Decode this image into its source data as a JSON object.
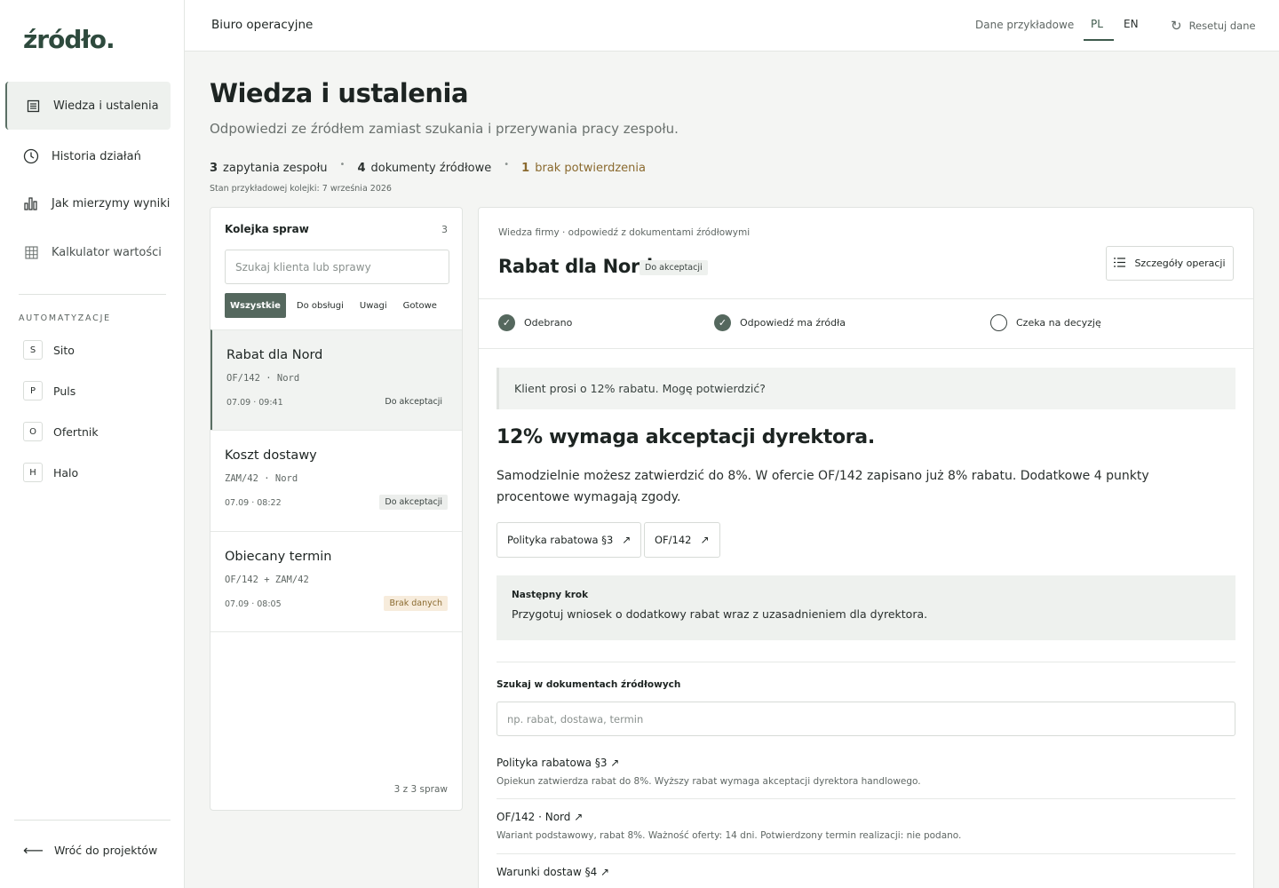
{
  "sidebar": {
    "logo": "źródło.",
    "nav": [
      {
        "label": "Wiedza i ustalenia",
        "icon": "list-icon"
      },
      {
        "label": "Historia działań",
        "icon": "clock-icon"
      },
      {
        "label": "Jak mierzymy wyniki",
        "icon": "bar-chart-icon"
      },
      {
        "label": "Kalkulator wartości",
        "icon": "grid-icon"
      }
    ],
    "section_label": "AUTOMATYZACJE",
    "automations": [
      {
        "badge": "S",
        "label": "Sito"
      },
      {
        "badge": "P",
        "label": "Puls"
      },
      {
        "badge": "O",
        "label": "Ofertnik"
      },
      {
        "badge": "H",
        "label": "Halo"
      }
    ],
    "back_label": "Wróć do projektów"
  },
  "topbar": {
    "title": "Biuro operacyjne",
    "sample_data": "Dane przykładowe",
    "lang_pl": "PL",
    "lang_en": "EN",
    "reset": "Resetuj dane"
  },
  "header": {
    "title": "Wiedza i ustalenia",
    "subtitle": "Odpowiedzi ze źródłem zamiast szukania i przerywania pracy zespołu.",
    "stats": [
      {
        "num": "3",
        "label": "zapytania zespołu"
      },
      {
        "num": "4",
        "label": "dokumenty źródłowe"
      },
      {
        "num": "1",
        "label": "brak potwierdzenia"
      }
    ],
    "queue_state": "Stan przykładowej kolejki: 7 września 2026"
  },
  "queue": {
    "title": "Kolejka spraw",
    "count": "3",
    "search_placeholder": "Szukaj klienta lub sprawy",
    "filters": [
      "Wszystkie",
      "Do obsługi",
      "Uwagi",
      "Gotowe"
    ],
    "items": [
      {
        "title": "Rabat dla Nord",
        "ref": "OF/142 · Nord",
        "time": "07.09 · 09:41",
        "badge": "Do akceptacji"
      },
      {
        "title": "Koszt dostawy",
        "ref": "ZAM/42 · Nord",
        "time": "07.09 · 08:22",
        "badge": "Do akceptacji"
      },
      {
        "title": "Obiecany termin",
        "ref": "OF/142 + ZAM/42",
        "time": "07.09 · 08:05",
        "badge": "Brak danych"
      }
    ],
    "footer": "3 z 3 spraw"
  },
  "detail": {
    "crumb": "Wiedza firmy · odpowiedź z dokumentami źródłowymi",
    "title": "Rabat dla Nord",
    "status": "Do akceptacji",
    "details_button": "Szczegóły operacji",
    "steps": [
      "Odebrano",
      "Odpowiedź ma źródła",
      "Czeka na decyzję"
    ],
    "question": "Klient prosi o 12% rabatu. Mogę potwierdzić?",
    "answer_title": "12% wymaga akceptacji dyrektora.",
    "answer_body": "Samodzielnie możesz zatwierdzić do 8%. W ofercie OF/142 zapisano już 8% rabatu. Dodatkowe 4 punkty procentowe wymagają zgody.",
    "sources": [
      "Polityka rabatowa §3",
      "OF/142"
    ],
    "next_label": "Następny krok",
    "next_text": "Przygotuj wniosek o dodatkowy rabat wraz z uzasadnieniem dla dyrektora.",
    "search_label": "Szukaj w dokumentach źródłowych",
    "search_placeholder": "np. rabat, dostawa, termin",
    "docs": [
      {
        "name": "Polityka rabatowa §3 ↗",
        "desc": "Opiekun zatwierdza rabat do 8%. Wyższy rabat wymaga akceptacji dyrektora handlowego."
      },
      {
        "name": "OF/142 · Nord ↗",
        "desc": "Wariant podstawowy, rabat 8%. Ważność oferty: 14 dni. Potwierdzony termin realizacji: nie podano."
      },
      {
        "name": "Warunki dostaw §4 ↗",
        "desc": ""
      }
    ]
  }
}
